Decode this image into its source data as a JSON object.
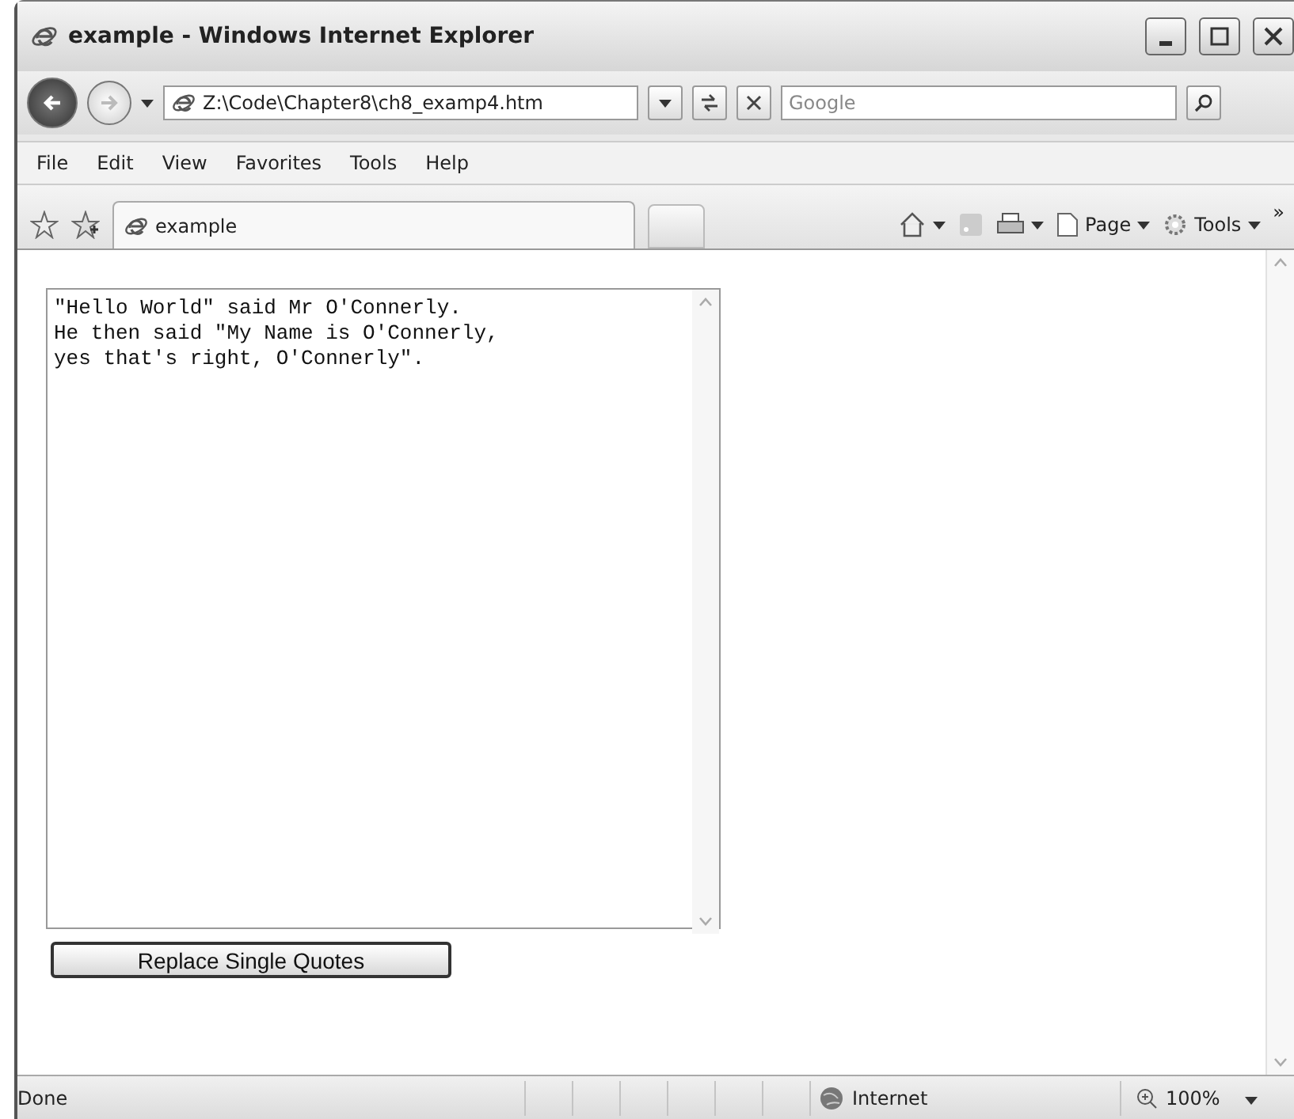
{
  "window": {
    "title": "example - Windows Internet Explorer"
  },
  "address_bar": {
    "url": "Z:\\Code\\Chapter8\\ch8_examp4.htm",
    "search_placeholder": "Google"
  },
  "menu": [
    "File",
    "Edit",
    "View",
    "Favorites",
    "Tools",
    "Help"
  ],
  "toolbar": {
    "tab": "example",
    "buttons": [
      "Page",
      "Tools"
    ],
    "overflow": "»"
  },
  "page": {
    "textarea": "\"Hello World\" said Mr O'Connerly.\nHe then said \"My Name is O'Connerly,\nyes that's right, O'Connerly\".",
    "button": "Replace Single Quotes"
  },
  "status_bar": {
    "status": "Done",
    "zone": "Internet",
    "zoom": "100%"
  }
}
